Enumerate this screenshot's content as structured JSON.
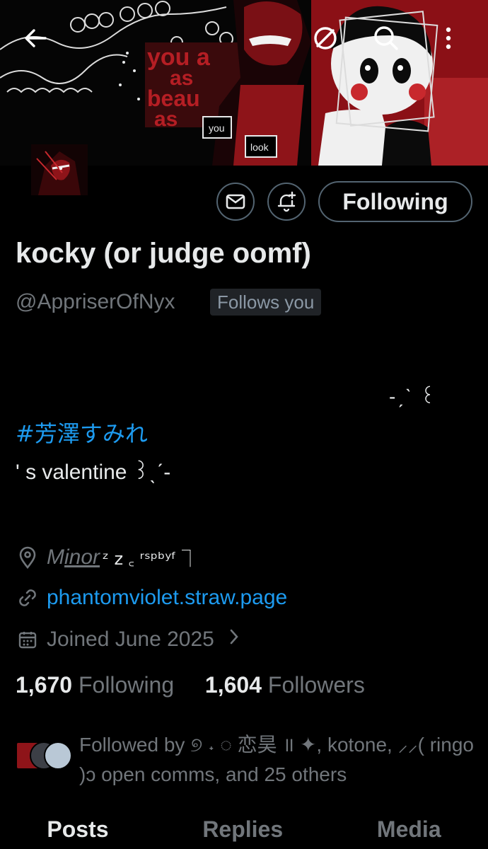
{
  "header": {
    "back_icon": "arrow-left-icon",
    "actions": [
      "circle-slash-icon",
      "search-icon",
      "more-vertical-icon"
    ],
    "banner_texts": [
      "you a",
      "as",
      "beau",
      "as",
      "you",
      "look"
    ]
  },
  "profile": {
    "display_name": "kocky (or judge oomf)",
    "handle": "@AppriserOfNyx",
    "follows_you_badge": "Follows you",
    "follow_button_label": "Following",
    "message_icon": "envelope-icon",
    "notify_icon": "bell-plus-icon"
  },
  "bio": {
    "deco_line": "-ˏˋ ꒰",
    "hashtag": "#芳澤すみれ",
    "line": "' s valentine  ꒱ˎˊ-"
  },
  "meta": {
    "location_prefix": "M",
    "location_underlined": "inor",
    "location_suffix": "  ᶻ z ꜀  ʳˢᵖᵇʸᶠ  ⏋",
    "link": "phantomviolet.straw.page",
    "joined": "Joined June 2025"
  },
  "stats": {
    "following_count": "1,670",
    "following_label": "Following",
    "followers_count": "1,604",
    "followers_label": "Followers"
  },
  "followed_by": {
    "text": "Followed by ୭ ˖ ◌ 恋昊 ॥ ✦, kotone, ⸝⸝( ringo )ɔ open comms, and 25 others"
  },
  "tabs": [
    "Posts",
    "Replies",
    "Media"
  ],
  "colors": {
    "accent_blue": "#1d9bf0",
    "muted": "#71767b",
    "text": "#e7e9ea",
    "banner_red": "#c8282d"
  }
}
